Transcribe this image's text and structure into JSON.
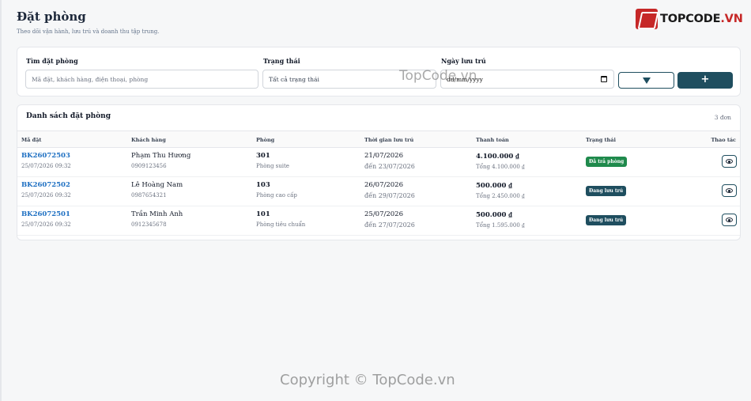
{
  "page": {
    "title": "Đặt phòng",
    "subtitle": "Theo dõi vận hành, lưu trú và doanh thu tập trung."
  },
  "logo": {
    "text_main": "TOPCODE",
    "text_dot": ".VN"
  },
  "filters": {
    "search_label": "Tìm đặt phòng",
    "search_placeholder": "Mã đặt, khách hàng, điện thoại, phòng",
    "status_label": "Trạng thái",
    "status_value": "Tất cả trạng thái",
    "date_label": "Ngày lưu trú",
    "date_value": "dd/mm/yyyy",
    "add_label": "+"
  },
  "list": {
    "title": "Danh sách đặt phòng",
    "count": "3 đơn",
    "columns": [
      "Mã đặt",
      "Khách hàng",
      "Phòng",
      "Thời gian lưu trú",
      "Thanh toán",
      "Trạng thái",
      "Thao tác"
    ],
    "rows": [
      {
        "code": "BK26072503",
        "created": "25/07/2026 09:32",
        "guest": "Phạm Thu Hương",
        "phone": "0909123456",
        "room": "301",
        "room_type": "Phòng suite",
        "checkin": "21/07/2026",
        "checkout": "đến 23/07/2026",
        "paid": "4.100.000 ₫",
        "total": "Tổng 4.100.000 ₫",
        "status": "Đã trả phòng",
        "status_kind": "done"
      },
      {
        "code": "BK26072502",
        "created": "25/07/2026 09:32",
        "guest": "Lê Hoàng Nam",
        "phone": "0987654321",
        "room": "103",
        "room_type": "Phòng cao cấp",
        "checkin": "26/07/2026",
        "checkout": "đến 29/07/2026",
        "paid": "500.000 ₫",
        "total": "Tổng 2.450.000 ₫",
        "status": "Đang lưu trú",
        "status_kind": "stay"
      },
      {
        "code": "BK26072501",
        "created": "25/07/2026 09:32",
        "guest": "Trần Minh Anh",
        "phone": "0912345678",
        "room": "101",
        "room_type": "Phòng tiêu chuẩn",
        "checkin": "25/07/2026",
        "checkout": "đến 27/07/2026",
        "paid": "500.000 ₫",
        "total": "Tổng 1.595.000 ₫",
        "status": "Đang lưu trú",
        "status_kind": "stay"
      }
    ]
  },
  "watermarks": {
    "top": "TopCode.vn",
    "bottom": "Copyright © TopCode.vn"
  },
  "colors": {
    "accent": "#1f4e5f",
    "link": "#1d6fc2",
    "success": "#1f8a4c",
    "brand_red": "#c62828"
  }
}
